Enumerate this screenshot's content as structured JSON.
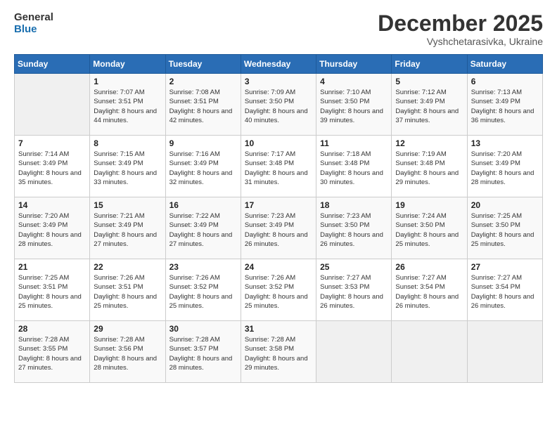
{
  "logo": {
    "text_general": "General",
    "text_blue": "Blue"
  },
  "header": {
    "month": "December 2025",
    "location": "Vyshchetarasivka, Ukraine"
  },
  "days_of_week": [
    "Sunday",
    "Monday",
    "Tuesday",
    "Wednesday",
    "Thursday",
    "Friday",
    "Saturday"
  ],
  "weeks": [
    [
      {
        "day": "",
        "sunrise": "",
        "sunset": "",
        "daylight": ""
      },
      {
        "day": "1",
        "sunrise": "Sunrise: 7:07 AM",
        "sunset": "Sunset: 3:51 PM",
        "daylight": "Daylight: 8 hours and 44 minutes."
      },
      {
        "day": "2",
        "sunrise": "Sunrise: 7:08 AM",
        "sunset": "Sunset: 3:51 PM",
        "daylight": "Daylight: 8 hours and 42 minutes."
      },
      {
        "day": "3",
        "sunrise": "Sunrise: 7:09 AM",
        "sunset": "Sunset: 3:50 PM",
        "daylight": "Daylight: 8 hours and 40 minutes."
      },
      {
        "day": "4",
        "sunrise": "Sunrise: 7:10 AM",
        "sunset": "Sunset: 3:50 PM",
        "daylight": "Daylight: 8 hours and 39 minutes."
      },
      {
        "day": "5",
        "sunrise": "Sunrise: 7:12 AM",
        "sunset": "Sunset: 3:49 PM",
        "daylight": "Daylight: 8 hours and 37 minutes."
      },
      {
        "day": "6",
        "sunrise": "Sunrise: 7:13 AM",
        "sunset": "Sunset: 3:49 PM",
        "daylight": "Daylight: 8 hours and 36 minutes."
      }
    ],
    [
      {
        "day": "7",
        "sunrise": "Sunrise: 7:14 AM",
        "sunset": "Sunset: 3:49 PM",
        "daylight": "Daylight: 8 hours and 35 minutes."
      },
      {
        "day": "8",
        "sunrise": "Sunrise: 7:15 AM",
        "sunset": "Sunset: 3:49 PM",
        "daylight": "Daylight: 8 hours and 33 minutes."
      },
      {
        "day": "9",
        "sunrise": "Sunrise: 7:16 AM",
        "sunset": "Sunset: 3:49 PM",
        "daylight": "Daylight: 8 hours and 32 minutes."
      },
      {
        "day": "10",
        "sunrise": "Sunrise: 7:17 AM",
        "sunset": "Sunset: 3:48 PM",
        "daylight": "Daylight: 8 hours and 31 minutes."
      },
      {
        "day": "11",
        "sunrise": "Sunrise: 7:18 AM",
        "sunset": "Sunset: 3:48 PM",
        "daylight": "Daylight: 8 hours and 30 minutes."
      },
      {
        "day": "12",
        "sunrise": "Sunrise: 7:19 AM",
        "sunset": "Sunset: 3:48 PM",
        "daylight": "Daylight: 8 hours and 29 minutes."
      },
      {
        "day": "13",
        "sunrise": "Sunrise: 7:20 AM",
        "sunset": "Sunset: 3:49 PM",
        "daylight": "Daylight: 8 hours and 28 minutes."
      }
    ],
    [
      {
        "day": "14",
        "sunrise": "Sunrise: 7:20 AM",
        "sunset": "Sunset: 3:49 PM",
        "daylight": "Daylight: 8 hours and 28 minutes."
      },
      {
        "day": "15",
        "sunrise": "Sunrise: 7:21 AM",
        "sunset": "Sunset: 3:49 PM",
        "daylight": "Daylight: 8 hours and 27 minutes."
      },
      {
        "day": "16",
        "sunrise": "Sunrise: 7:22 AM",
        "sunset": "Sunset: 3:49 PM",
        "daylight": "Daylight: 8 hours and 27 minutes."
      },
      {
        "day": "17",
        "sunrise": "Sunrise: 7:23 AM",
        "sunset": "Sunset: 3:49 PM",
        "daylight": "Daylight: 8 hours and 26 minutes."
      },
      {
        "day": "18",
        "sunrise": "Sunrise: 7:23 AM",
        "sunset": "Sunset: 3:50 PM",
        "daylight": "Daylight: 8 hours and 26 minutes."
      },
      {
        "day": "19",
        "sunrise": "Sunrise: 7:24 AM",
        "sunset": "Sunset: 3:50 PM",
        "daylight": "Daylight: 8 hours and 25 minutes."
      },
      {
        "day": "20",
        "sunrise": "Sunrise: 7:25 AM",
        "sunset": "Sunset: 3:50 PM",
        "daylight": "Daylight: 8 hours and 25 minutes."
      }
    ],
    [
      {
        "day": "21",
        "sunrise": "Sunrise: 7:25 AM",
        "sunset": "Sunset: 3:51 PM",
        "daylight": "Daylight: 8 hours and 25 minutes."
      },
      {
        "day": "22",
        "sunrise": "Sunrise: 7:26 AM",
        "sunset": "Sunset: 3:51 PM",
        "daylight": "Daylight: 8 hours and 25 minutes."
      },
      {
        "day": "23",
        "sunrise": "Sunrise: 7:26 AM",
        "sunset": "Sunset: 3:52 PM",
        "daylight": "Daylight: 8 hours and 25 minutes."
      },
      {
        "day": "24",
        "sunrise": "Sunrise: 7:26 AM",
        "sunset": "Sunset: 3:52 PM",
        "daylight": "Daylight: 8 hours and 25 minutes."
      },
      {
        "day": "25",
        "sunrise": "Sunrise: 7:27 AM",
        "sunset": "Sunset: 3:53 PM",
        "daylight": "Daylight: 8 hours and 26 minutes."
      },
      {
        "day": "26",
        "sunrise": "Sunrise: 7:27 AM",
        "sunset": "Sunset: 3:54 PM",
        "daylight": "Daylight: 8 hours and 26 minutes."
      },
      {
        "day": "27",
        "sunrise": "Sunrise: 7:27 AM",
        "sunset": "Sunset: 3:54 PM",
        "daylight": "Daylight: 8 hours and 26 minutes."
      }
    ],
    [
      {
        "day": "28",
        "sunrise": "Sunrise: 7:28 AM",
        "sunset": "Sunset: 3:55 PM",
        "daylight": "Daylight: 8 hours and 27 minutes."
      },
      {
        "day": "29",
        "sunrise": "Sunrise: 7:28 AM",
        "sunset": "Sunset: 3:56 PM",
        "daylight": "Daylight: 8 hours and 28 minutes."
      },
      {
        "day": "30",
        "sunrise": "Sunrise: 7:28 AM",
        "sunset": "Sunset: 3:57 PM",
        "daylight": "Daylight: 8 hours and 28 minutes."
      },
      {
        "day": "31",
        "sunrise": "Sunrise: 7:28 AM",
        "sunset": "Sunset: 3:58 PM",
        "daylight": "Daylight: 8 hours and 29 minutes."
      },
      {
        "day": "",
        "sunrise": "",
        "sunset": "",
        "daylight": ""
      },
      {
        "day": "",
        "sunrise": "",
        "sunset": "",
        "daylight": ""
      },
      {
        "day": "",
        "sunrise": "",
        "sunset": "",
        "daylight": ""
      }
    ]
  ]
}
